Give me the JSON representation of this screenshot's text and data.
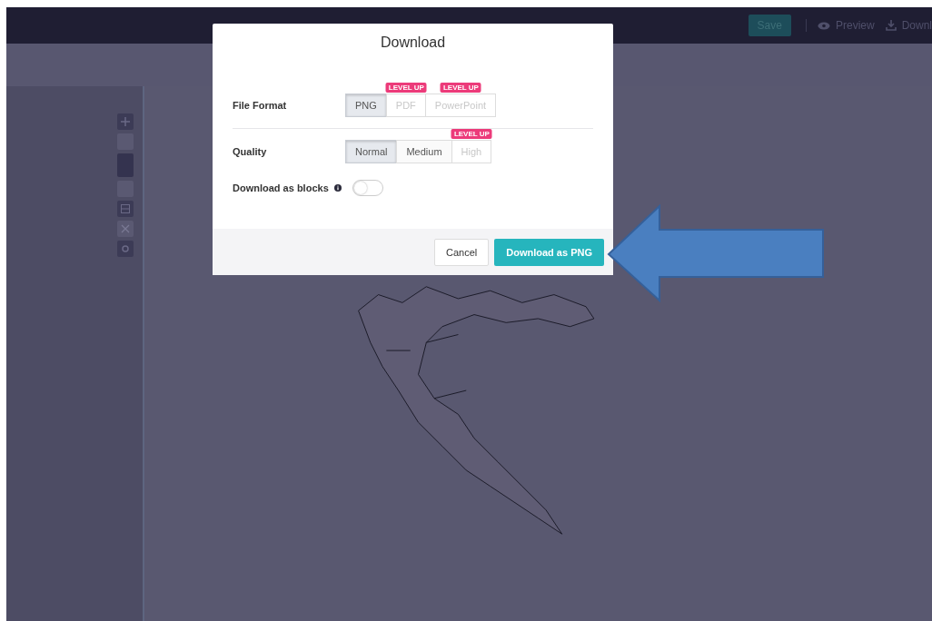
{
  "top_bar": {
    "save_button": "Save",
    "preview_link": "Preview",
    "download_link": "Downl"
  },
  "dialog": {
    "title": "Download",
    "rows": [
      {
        "kind": "segments",
        "label": "File Format",
        "options": [
          {
            "label": "PNG",
            "selected": true,
            "disabled": false
          },
          {
            "label": "PDF",
            "selected": false,
            "disabled": true,
            "badge": "LEVEL UP"
          },
          {
            "label": "PowerPoint",
            "selected": false,
            "disabled": true,
            "badge": "LEVEL UP"
          }
        ]
      },
      {
        "kind": "segments",
        "label": "Quality",
        "options": [
          {
            "label": "Normal",
            "selected": true,
            "disabled": false
          },
          {
            "label": "Medium",
            "selected": false,
            "disabled": false
          },
          {
            "label": "High",
            "selected": false,
            "disabled": true,
            "badge": "LEVEL UP"
          }
        ]
      },
      {
        "kind": "toggle",
        "label": "Download as blocks",
        "on": false
      }
    ],
    "cancel_button": "Cancel",
    "confirm_button": "Download as PNG"
  }
}
